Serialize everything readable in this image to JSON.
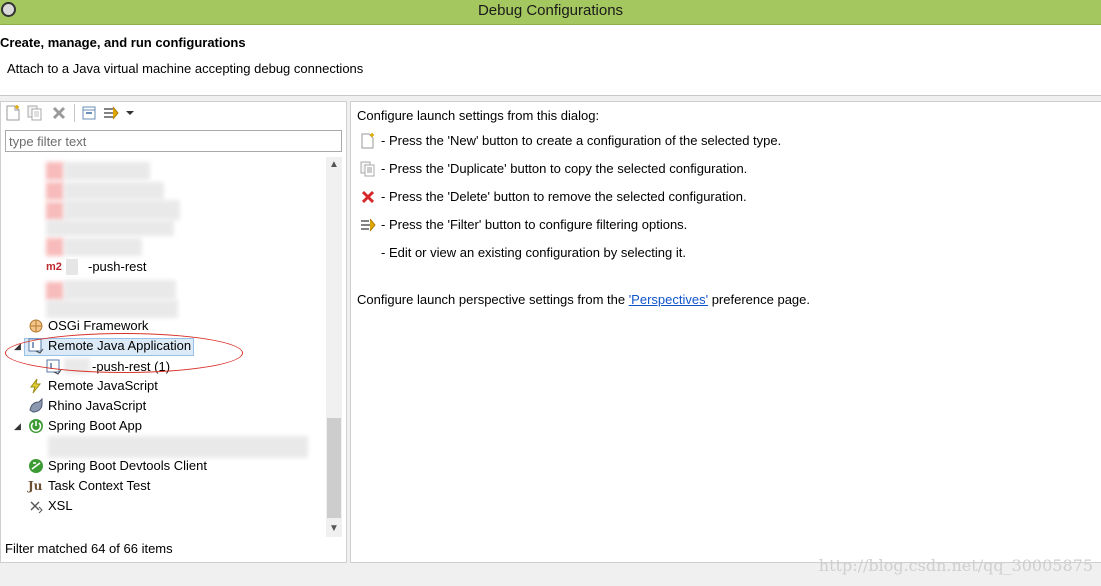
{
  "window": {
    "title": "Debug Configurations"
  },
  "header": {
    "title": "Create, manage, and run configurations",
    "description": "Attach to a Java virtual machine accepting debug connections"
  },
  "filter": {
    "placeholder": "type filter text",
    "status": "Filter matched 64 of 66 items"
  },
  "tree": {
    "items": [
      {
        "label": "-push-rest",
        "icon": "maven-m2-icon",
        "prefix": "m2"
      },
      {
        "label": "OSGi Framework",
        "icon": "osgi-icon"
      },
      {
        "label": "Remote Java Application",
        "icon": "remote-java-app-icon",
        "expanded": true,
        "selected": true
      },
      {
        "label": "-push-rest (1)",
        "icon": "remote-java-config-icon"
      },
      {
        "label": "Remote JavaScript",
        "icon": "remote-javascript-icon"
      },
      {
        "label": "Rhino JavaScript",
        "icon": "rhino-icon"
      },
      {
        "label": "Spring Boot App",
        "icon": "spring-boot-icon",
        "expanded": true
      },
      {
        "label": "Spring Boot Devtools Client",
        "icon": "spring-devtools-icon"
      },
      {
        "label": "Task Context Test",
        "icon": "junit-icon"
      },
      {
        "label": "XSL",
        "icon": "xsl-icon"
      }
    ]
  },
  "help": {
    "intro": "Configure launch settings from this dialog:",
    "lines": [
      {
        "text": "- Press the 'New' button to create a configuration of the selected type.",
        "icon": "new-config-icon"
      },
      {
        "text": "- Press the 'Duplicate' button to copy the selected configuration.",
        "icon": "duplicate-icon"
      },
      {
        "text": "- Press the 'Delete' button to remove the selected configuration.",
        "icon": "delete-icon"
      },
      {
        "text": "- Press the 'Filter' button to configure filtering options.",
        "icon": "filter-icon"
      },
      {
        "text": "- Edit or view an existing configuration by selecting it.",
        "icon": ""
      }
    ],
    "perspective_prefix": "Configure launch perspective settings from the ",
    "perspective_link": "'Perspectives'",
    "perspective_suffix": " preference page."
  },
  "watermark": "http://blog.csdn.net/qq_30005875",
  "colors": {
    "titlebar": "#a4c75f",
    "annotation": "#d9332b",
    "link": "#1155cc"
  }
}
